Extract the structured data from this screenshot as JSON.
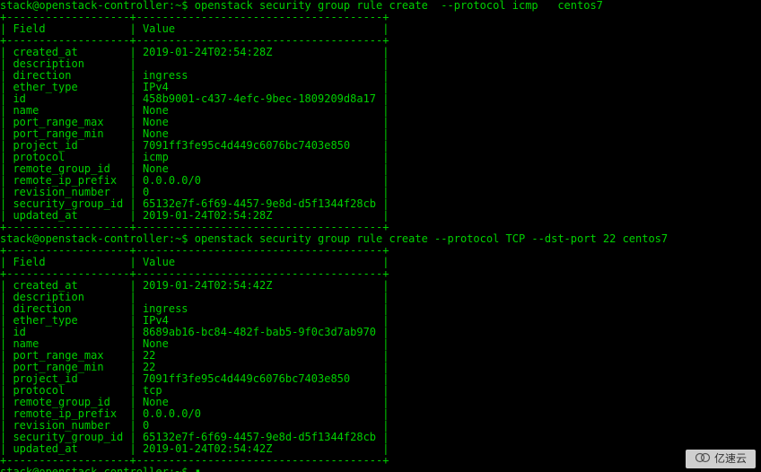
{
  "prompt_prefix": "stack@openstack-controller:~$ ",
  "cmd1": "openstack security group rule create  --protocol icmp   centos7",
  "cmd2": "openstack security group rule create --protocol TCP --dst-port 22 centos7",
  "table_header_field": "Field",
  "table_header_value": "Value",
  "table1": [
    [
      "created_at",
      "2019-01-24T02:54:28Z"
    ],
    [
      "description",
      ""
    ],
    [
      "direction",
      "ingress"
    ],
    [
      "ether_type",
      "IPv4"
    ],
    [
      "id",
      "458b9001-c437-4efc-9bec-1809209d8a17"
    ],
    [
      "name",
      "None"
    ],
    [
      "port_range_max",
      "None"
    ],
    [
      "port_range_min",
      "None"
    ],
    [
      "project_id",
      "7091ff3fe95c4d449c6076bc7403e850"
    ],
    [
      "protocol",
      "icmp"
    ],
    [
      "remote_group_id",
      "None"
    ],
    [
      "remote_ip_prefix",
      "0.0.0.0/0"
    ],
    [
      "revision_number",
      "0"
    ],
    [
      "security_group_id",
      "65132e7f-6f69-4457-9e8d-d5f1344f28cb"
    ],
    [
      "updated_at",
      "2019-01-24T02:54:28Z"
    ]
  ],
  "table2": [
    [
      "created_at",
      "2019-01-24T02:54:42Z"
    ],
    [
      "description",
      ""
    ],
    [
      "direction",
      "ingress"
    ],
    [
      "ether_type",
      "IPv4"
    ],
    [
      "id",
      "8689ab16-bc84-482f-bab5-9f0c3d7ab970"
    ],
    [
      "name",
      "None"
    ],
    [
      "port_range_max",
      "22"
    ],
    [
      "port_range_min",
      "22"
    ],
    [
      "project_id",
      "7091ff3fe95c4d449c6076bc7403e850"
    ],
    [
      "protocol",
      "tcp"
    ],
    [
      "remote_group_id",
      "None"
    ],
    [
      "remote_ip_prefix",
      "0.0.0.0/0"
    ],
    [
      "revision_number",
      "0"
    ],
    [
      "security_group_id",
      "65132e7f-6f69-4457-9e8d-d5f1344f28cb"
    ],
    [
      "updated_at",
      "2019-01-24T02:54:42Z"
    ]
  ],
  "cursor_glyph": "▮",
  "watermark_text": "亿速云",
  "layout": {
    "col1_width": 19,
    "col2_width": 38
  }
}
